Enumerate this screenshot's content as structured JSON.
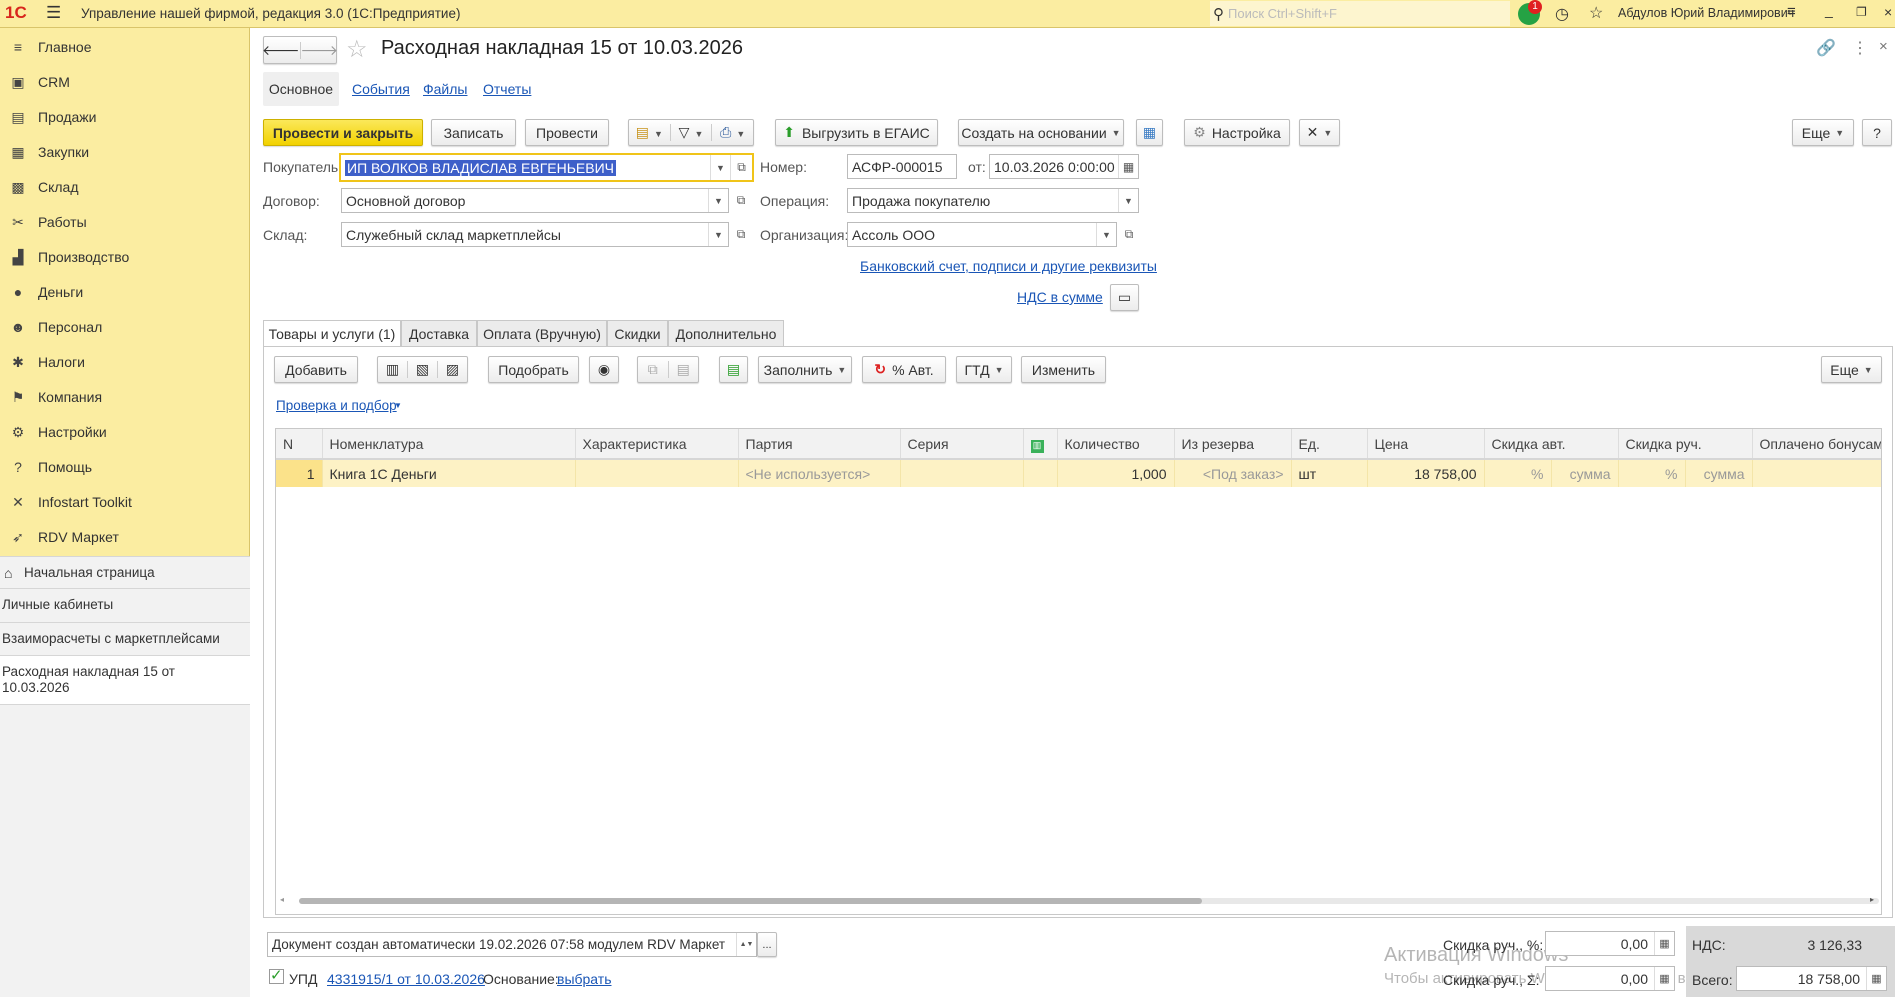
{
  "app": {
    "title": "Управление нашей фирмой, редакция 3.0  (1С:Предприятие)",
    "search_placeholder": "Поиск Ctrl+Shift+F",
    "notifications_count": "1",
    "user": "Абдулов Юрий Владимирович"
  },
  "sidebar": {
    "items": [
      {
        "label": "Главное",
        "icon": "≡"
      },
      {
        "label": "CRM",
        "icon": "▣"
      },
      {
        "label": "Продажи",
        "icon": "▤"
      },
      {
        "label": "Закупки",
        "icon": "▦"
      },
      {
        "label": "Склад",
        "icon": "▩"
      },
      {
        "label": "Работы",
        "icon": "✂"
      },
      {
        "label": "Производство",
        "icon": "▟"
      },
      {
        "label": "Деньги",
        "icon": "●"
      },
      {
        "label": "Персонал",
        "icon": "☻"
      },
      {
        "label": "Налоги",
        "icon": "✱"
      },
      {
        "label": "Компания",
        "icon": "⚑"
      },
      {
        "label": "Настройки",
        "icon": "⚙"
      },
      {
        "label": "Помощь",
        "icon": "?"
      },
      {
        "label": "Infostart Toolkit",
        "icon": "✕"
      },
      {
        "label": "RDV Маркет",
        "icon": "➶"
      }
    ],
    "home": "Начальная страница",
    "cabinets": "Личные кабинеты",
    "settlements": "Взаиморасчеты с маркетплейсами",
    "current_doc": "Расходная накладная 15 от 10.03.2026"
  },
  "doc": {
    "title": "Расходная накладная 15 от 10.03.2026",
    "nav_tabs": [
      "Основное",
      "События",
      "Файлы",
      "Отчеты"
    ],
    "toolbar": {
      "post_close": "Провести и закрыть",
      "save": "Записать",
      "post": "Провести",
      "egais": "Выгрузить в ЕГАИС",
      "create_based": "Создать на основании",
      "settings": "Настройка",
      "more": "Еще",
      "help": "?"
    },
    "fields": {
      "buyer_label": "Покупатель:",
      "buyer": "ИП ВОЛКОВ ВЛАДИСЛАВ ЕВГЕНЬЕВИЧ",
      "contract_label": "Договор:",
      "contract": "Основной договор",
      "warehouse_label": "Склад:",
      "warehouse": "Служебный склад маркетплейсы",
      "number_label": "Номер:",
      "number": "АСФР-000015",
      "date_label": "от:",
      "date": "10.03.2026  0:00:00",
      "operation_label": "Операция:",
      "operation": "Продажа покупателю",
      "org_label": "Организация:",
      "org": "Ассоль ООО"
    },
    "bank_link": "Банковский счет, подписи и другие реквизиты",
    "vat_link": "НДС в сумме",
    "tabs": [
      "Товары и услуги (1)",
      "Доставка",
      "Оплата (Вручную)",
      "Скидки",
      "Дополнительно"
    ],
    "table_toolbar": {
      "add": "Добавить",
      "pick": "Подобрать",
      "fill": "Заполнить",
      "auto_pct": "% Авт.",
      "gtd": "ГТД",
      "change": "Изменить",
      "more": "Еще"
    },
    "check_link": "Проверка и подбор",
    "columns": [
      "N",
      "Номенклатура",
      "Характеристика",
      "Партия",
      "Серия",
      "",
      "Количество",
      "Из резерва",
      "Ед.",
      "Цена",
      "Скидка авт.",
      "Скидка руч.",
      "Оплачено бонусами"
    ],
    "rows": [
      {
        "n": "1",
        "item": "Книга 1С Деньги",
        "char": "",
        "batch": "<Не используется>",
        "series": "",
        "qty": "1,000",
        "reserve": "<Под заказ>",
        "unit": "шт",
        "price": "18 758,00",
        "auto_pct": "%",
        "auto_sum": "сумма",
        "man_pct": "%",
        "man_sum": "сумма",
        "bonus": ""
      }
    ],
    "comment": "Документ создан автоматически 19.02.2026 07:58 модулем RDV Маркет",
    "upd_label": "УПД",
    "upd_link": "4331915/1 от 10.03.2026",
    "basis_label": "Основание:",
    "basis_link": "выбрать",
    "disc_pct_label": "Скидка руч., %:",
    "disc_pct": "0,00",
    "disc_sum_label": "Скидка руч., Σ:",
    "disc_sum": "0,00",
    "vat_label": "НДС:",
    "vat": "3 126,33",
    "total_label": "Всего:",
    "total": "18 758,00"
  },
  "watermark": {
    "line1": "Активация Windows",
    "line2": "Чтобы активировать Windows, перейдите в раздел \"Параметры\"."
  }
}
